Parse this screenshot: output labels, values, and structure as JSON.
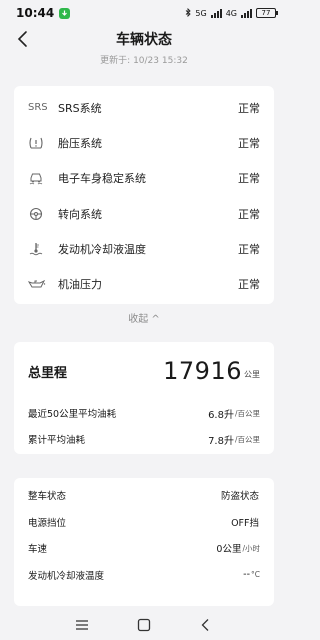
{
  "status_bar": {
    "time": "10:44",
    "network": "5G",
    "network2": "4G",
    "battery": "77"
  },
  "header": {
    "title": "车辆状态",
    "updated": "更新于: 10/23 15:32"
  },
  "systems": [
    {
      "icon": "srs-icon",
      "icon_text": "SRS",
      "label": "SRS系统",
      "status": "正常"
    },
    {
      "icon": "tire-pressure-icon",
      "label": "胎压系统",
      "status": "正常"
    },
    {
      "icon": "stability-control-icon",
      "label": "电子车身稳定系统",
      "status": "正常"
    },
    {
      "icon": "steering-wheel-icon",
      "label": "转向系统",
      "status": "正常"
    },
    {
      "icon": "coolant-temperature-icon",
      "label": "发动机冷却液温度",
      "status": "正常"
    },
    {
      "icon": "oil-can-icon",
      "label": "机油压力",
      "status": "正常"
    }
  ],
  "collapse_label": "收起 ^",
  "mileage": {
    "label": "总里程",
    "value": "17916",
    "unit": "公里",
    "fuel": [
      {
        "label": "最近50公里平均油耗",
        "value": "6.8升",
        "unit": "/百公里"
      },
      {
        "label": "累计平均油耗",
        "value": "7.8升",
        "unit": "/百公里"
      }
    ]
  },
  "vehicle_state": [
    {
      "label": "整车状态",
      "value": "防盗状态",
      "unit": ""
    },
    {
      "label": "电源挡位",
      "value": "OFF挡",
      "unit": ""
    },
    {
      "label": "车速",
      "value": "0公里",
      "unit": "/小时"
    },
    {
      "label": "发动机冷却液温度",
      "value": "--",
      "unit": "°C"
    }
  ]
}
